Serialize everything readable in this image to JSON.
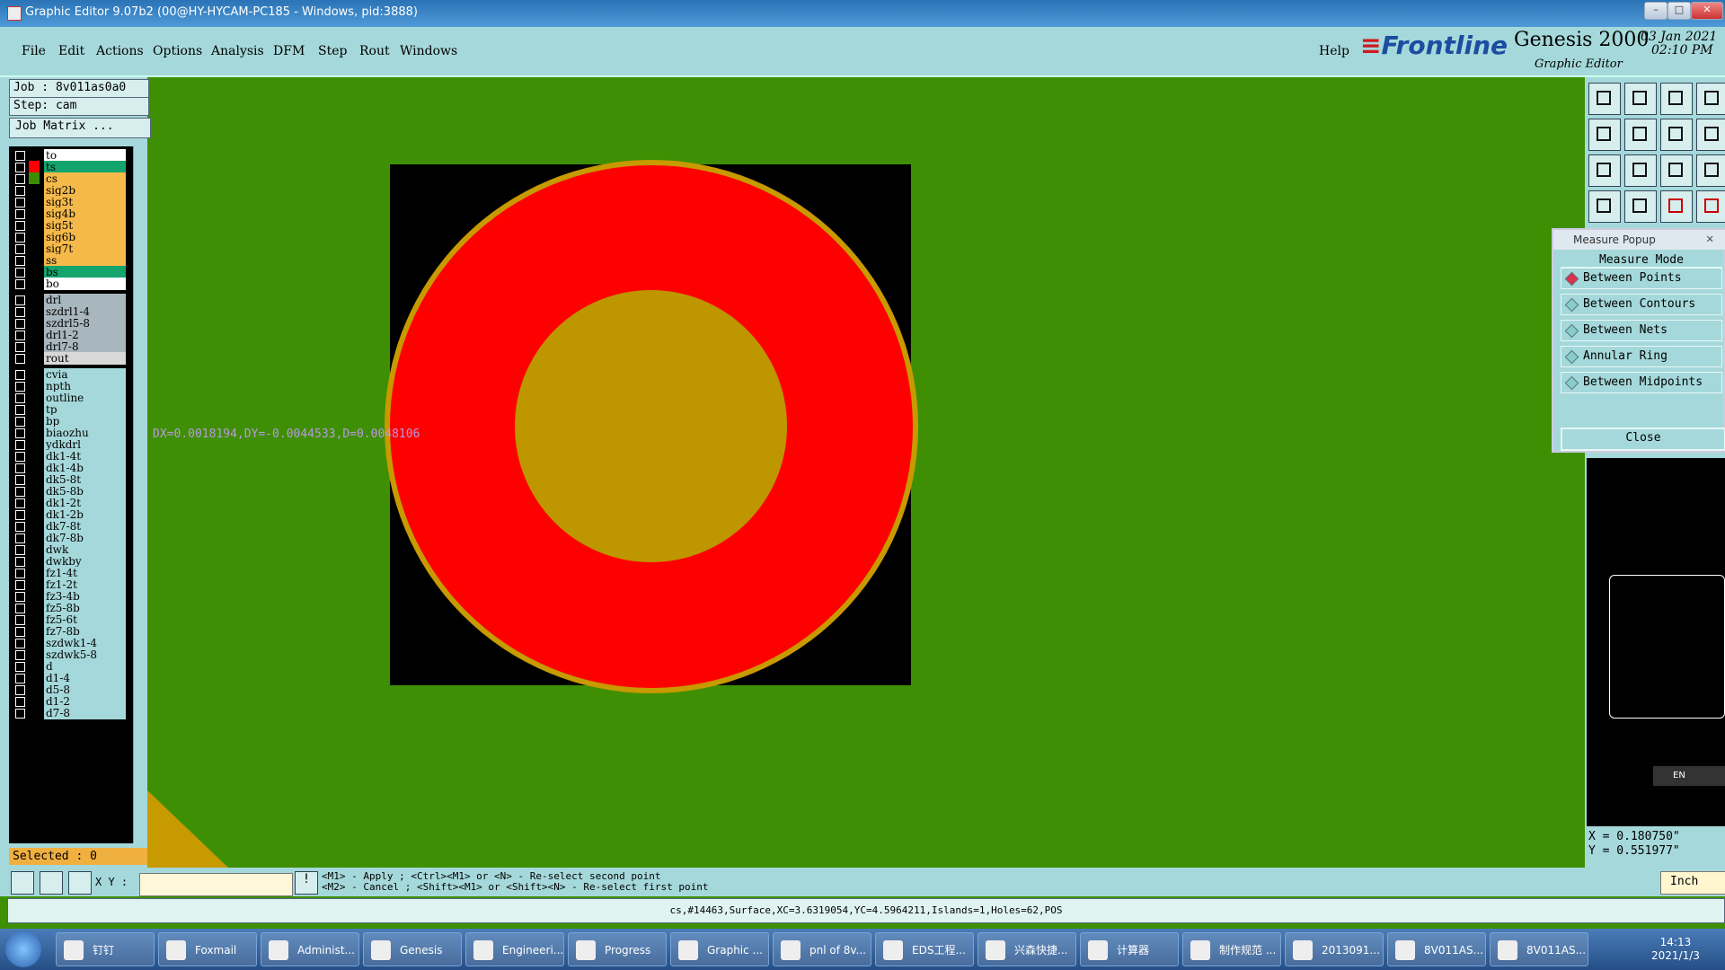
{
  "window": {
    "title": "Graphic Editor 9.07b2 (00@HY-HYCAM-PC185 - Windows, pid:3888)"
  },
  "menu": {
    "items": [
      "File",
      "Edit",
      "Actions",
      "Options",
      "Analysis",
      "DFM",
      "Step",
      "Rout",
      "Windows"
    ],
    "help": "Help"
  },
  "brand": {
    "logo": "Frontline",
    "product": "Genesis 2000",
    "subtitle": "Graphic Editor",
    "date": "03 Jan 2021",
    "time": "02:10 PM"
  },
  "job": {
    "job_label": "Job : 8v011as0a0",
    "step_label": "Step: cam",
    "matrix_button": "Job Matrix ..."
  },
  "layers": [
    {
      "name": "to",
      "color": "#ffffff",
      "swatch": "#000000"
    },
    {
      "name": "ts",
      "color": "#14a56c",
      "swatch": "#ff0000"
    },
    {
      "name": "cs",
      "color": "#f5b94a",
      "swatch": "#3c8c04"
    },
    {
      "name": "sig2b",
      "color": "#f5b94a",
      "swatch": "#000000"
    },
    {
      "name": "sig3t",
      "color": "#f5b94a",
      "swatch": "#000000"
    },
    {
      "name": "sig4b",
      "color": "#f5b94a",
      "swatch": "#000000"
    },
    {
      "name": "sig5t",
      "color": "#f5b94a",
      "swatch": "#000000"
    },
    {
      "name": "sig6b",
      "color": "#f5b94a",
      "swatch": "#000000"
    },
    {
      "name": "sig7t",
      "color": "#f5b94a",
      "swatch": "#000000"
    },
    {
      "name": "ss",
      "color": "#f5b94a",
      "swatch": "#000000"
    },
    {
      "name": "bs",
      "color": "#14a56c",
      "swatch": "#000000"
    },
    {
      "name": "bo",
      "color": "#ffffff",
      "swatch": "#000000"
    },
    {
      "name": "drl",
      "color": "#a8b6bd",
      "swatch": "#000000",
      "gap": true
    },
    {
      "name": "szdrl1-4",
      "color": "#a8b6bd",
      "swatch": "#000000"
    },
    {
      "name": "szdrl5-8",
      "color": "#a8b6bd",
      "swatch": "#000000"
    },
    {
      "name": "drl1-2",
      "color": "#a8b6bd",
      "swatch": "#000000"
    },
    {
      "name": "drl7-8",
      "color": "#a8b6bd",
      "swatch": "#000000"
    },
    {
      "name": "rout",
      "color": "#d8d8d8",
      "swatch": "#000000"
    },
    {
      "name": "cvia",
      "color": "#a5d8da",
      "swatch": "#000000",
      "gap": true
    },
    {
      "name": "npth",
      "color": "#a5d8da",
      "swatch": "#000000"
    },
    {
      "name": "outline",
      "color": "#a5d8da",
      "swatch": "#000000"
    },
    {
      "name": "tp",
      "color": "#a5d8da",
      "swatch": "#000000"
    },
    {
      "name": "bp",
      "color": "#a5d8da",
      "swatch": "#000000"
    },
    {
      "name": "biaozhu",
      "color": "#a5d8da",
      "swatch": "#000000"
    },
    {
      "name": "ydkdrl",
      "color": "#a5d8da",
      "swatch": "#000000"
    },
    {
      "name": "dk1-4t",
      "color": "#a5d8da",
      "swatch": "#000000"
    },
    {
      "name": "dk1-4b",
      "color": "#a5d8da",
      "swatch": "#000000"
    },
    {
      "name": "dk5-8t",
      "color": "#a5d8da",
      "swatch": "#000000"
    },
    {
      "name": "dk5-8b",
      "color": "#a5d8da",
      "swatch": "#000000"
    },
    {
      "name": "dk1-2t",
      "color": "#a5d8da",
      "swatch": "#000000"
    },
    {
      "name": "dk1-2b",
      "color": "#a5d8da",
      "swatch": "#000000"
    },
    {
      "name": "dk7-8t",
      "color": "#a5d8da",
      "swatch": "#000000"
    },
    {
      "name": "dk7-8b",
      "color": "#a5d8da",
      "swatch": "#000000"
    },
    {
      "name": "dwk",
      "color": "#a5d8da",
      "swatch": "#000000"
    },
    {
      "name": "dwkby",
      "color": "#a5d8da",
      "swatch": "#000000"
    },
    {
      "name": "fz1-4t",
      "color": "#a5d8da",
      "swatch": "#000000"
    },
    {
      "name": "fz1-2t",
      "color": "#a5d8da",
      "swatch": "#000000"
    },
    {
      "name": "fz3-4b",
      "color": "#a5d8da",
      "swatch": "#000000"
    },
    {
      "name": "fz5-8b",
      "color": "#a5d8da",
      "swatch": "#000000"
    },
    {
      "name": "fz5-6t",
      "color": "#a5d8da",
      "swatch": "#000000"
    },
    {
      "name": "fz7-8b",
      "color": "#a5d8da",
      "swatch": "#000000"
    },
    {
      "name": "szdwk1-4",
      "color": "#a5d8da",
      "swatch": "#000000"
    },
    {
      "name": "szdwk5-8",
      "color": "#a5d8da",
      "swatch": "#000000"
    },
    {
      "name": "d",
      "color": "#a5d8da",
      "swatch": "#000000"
    },
    {
      "name": "d1-4",
      "color": "#a5d8da",
      "swatch": "#000000"
    },
    {
      "name": "d5-8",
      "color": "#a5d8da",
      "swatch": "#000000"
    },
    {
      "name": "d1-2",
      "color": "#a5d8da",
      "swatch": "#000000"
    },
    {
      "name": "d7-8",
      "color": "#a5d8da",
      "swatch": "#000000"
    }
  ],
  "selected": "Selected : 0",
  "canvas": {
    "measure_text": "DX=0.0018194,DY=-0.0044533,D=0.0048106"
  },
  "measure_popup": {
    "title": "Measure Popup",
    "mode_label": "Measure Mode",
    "modes": [
      "Between Points",
      "Between Contours",
      "Between Nets",
      "Annular Ring",
      "Between Midpoints"
    ],
    "selected_mode": "Between Points",
    "close": "Close"
  },
  "coords": {
    "x": "X = 0.180750\"",
    "y": "Y = 0.551977\""
  },
  "ime": {
    "label": "EN"
  },
  "command": {
    "xy_label": "X Y :",
    "xy_value": "",
    "hint_line1": "<M1> - Apply  ; <Ctrl><M1> or <N> - Re-select second point",
    "hint_line2": "<M2> - Cancel ; <Shift><M1> or <Shift><N> - Re-select first point",
    "units": "Inch"
  },
  "status": "cs,#14463,Surface,XC=3.6319054,YC=4.5964211,Islands=1,Holes=62,POS",
  "taskbar": {
    "items": [
      "钉钉",
      "Foxmail",
      "Administ...",
      "Genesis",
      "Engineeri...",
      "Progress",
      "Graphic ...",
      "pnl of 8v...",
      "EDS工程...",
      "兴森快捷...",
      "计算器",
      "制作规范 ...",
      "2013091...",
      "8V011AS...",
      "8V011AS..."
    ],
    "time": "14:13",
    "date": "2021/1/3"
  },
  "colors": {
    "board": "#3f8f04",
    "pad": "#ff0000",
    "hole": "#be9600",
    "panel": "#a5d8da"
  }
}
